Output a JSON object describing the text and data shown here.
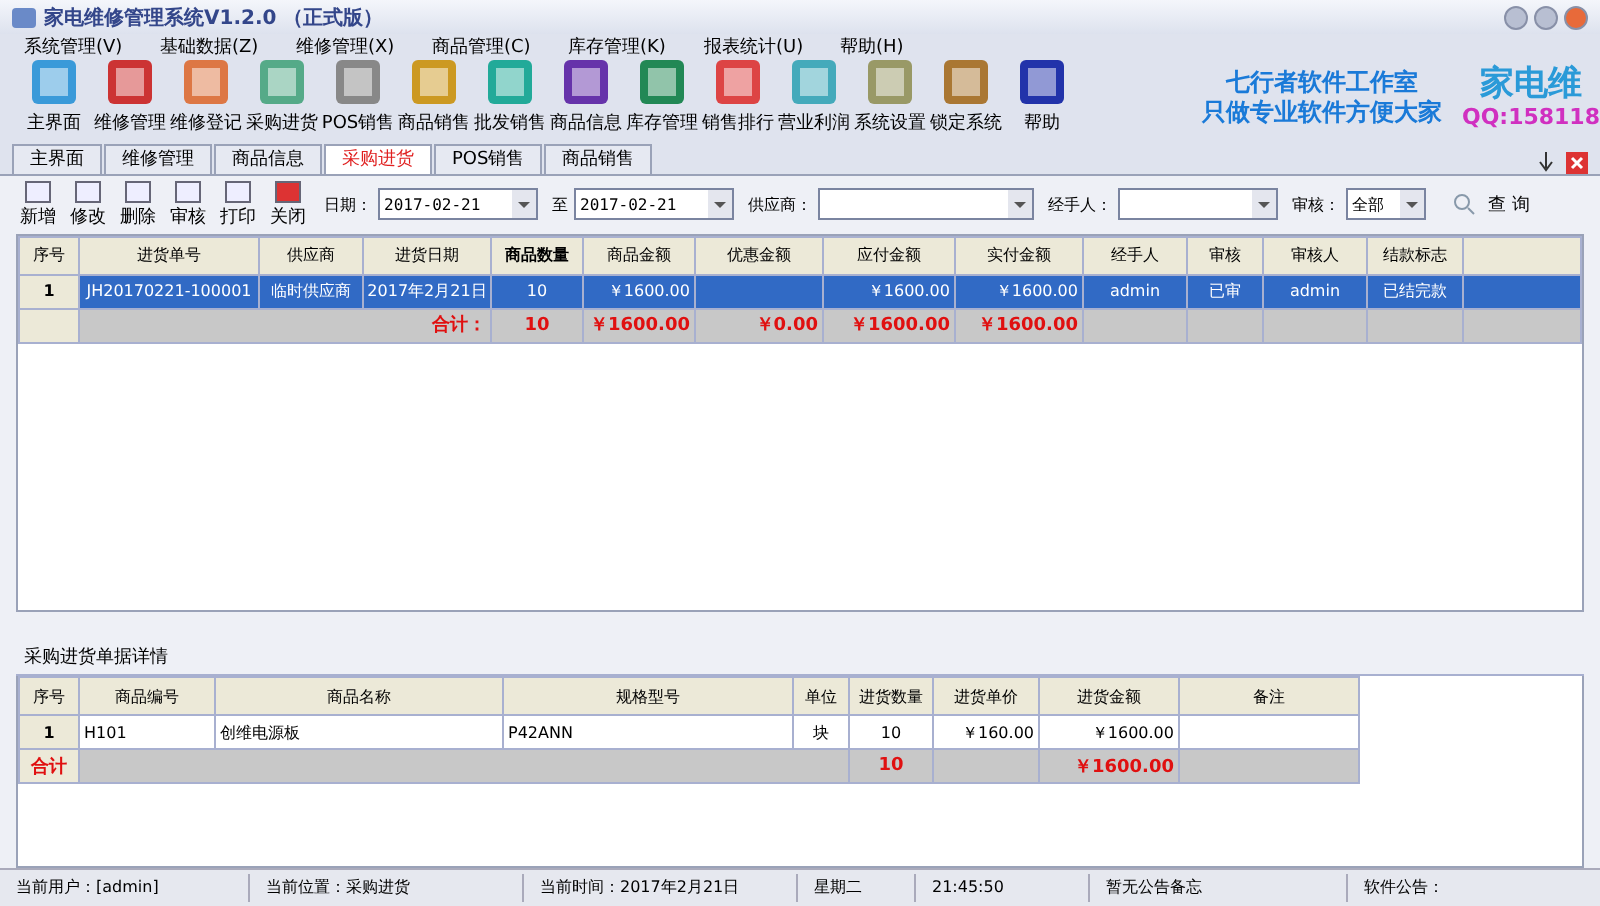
{
  "window": {
    "title": "家电维修管理系统V1.2.0 （正式版）"
  },
  "menu": [
    "系统管理(V)",
    "基础数据(Z)",
    "维修管理(X)",
    "商品管理(C)",
    "库存管理(K)",
    "报表统计(U)",
    "帮助(H)"
  ],
  "toolbar": [
    "主界面",
    "维修管理",
    "维修登记",
    "采购进货",
    "POS销售",
    "商品销售",
    "批发销售",
    "商品信息",
    "库存管理",
    "销售排行",
    "营业利润",
    "系统设置",
    "锁定系统",
    "帮助"
  ],
  "banner": {
    "line_1": "七行者软件工作室",
    "line_2": "只做专业软件方便大家",
    "brand": "家电维",
    "qq": "QQ:158118"
  },
  "tabs": [
    {
      "label": "主界面",
      "selected": false
    },
    {
      "label": "维修管理",
      "selected": false
    },
    {
      "label": "商品信息",
      "selected": false
    },
    {
      "label": "采购进货",
      "selected": true
    },
    {
      "label": "POS销售",
      "selected": false
    },
    {
      "label": "商品销售",
      "selected": false
    }
  ],
  "actions": [
    "新增",
    "修改",
    "删除",
    "审核",
    "打印",
    "关闭"
  ],
  "filters": {
    "date_label": "日期：",
    "date_from": "2017-02-21",
    "to_label": "至",
    "date_to": "2017-02-21",
    "supplier_label": "供应商：",
    "handler_label": "经手人：",
    "audit_label": "审核：",
    "audit_value": "全部",
    "query": "查 询"
  },
  "orders": {
    "columns": [
      "序号",
      "进货单号",
      "供应商",
      "进货日期",
      "商品数量",
      "商品金额",
      "优惠金额",
      "应付金额",
      "实付金额",
      "经手人",
      "审核",
      "审核人",
      "结款标志"
    ],
    "rows": [
      {
        "cells": [
          "1",
          "JH20170221-100001",
          "临时供应商",
          "2017年2月21日",
          "10",
          "￥1600.00",
          "",
          "￥1600.00",
          "￥1600.00",
          "admin",
          "已审",
          "admin",
          "已结完款"
        ],
        "selected": true
      }
    ],
    "total": {
      "label": "合计：",
      "qty": "10",
      "amount": "￥1600.00",
      "discount": "￥0.00",
      "payable": "￥1600.00",
      "paid": "￥1600.00"
    }
  },
  "details": {
    "title": "采购进货单据详情",
    "columns": [
      "序号",
      "商品编号",
      "商品名称",
      "规格型号",
      "单位",
      "进货数量",
      "进货单价",
      "进货金额",
      "备注"
    ],
    "rows": [
      [
        "1",
        "H101",
        "创维电源板",
        "P42ANN",
        "块",
        "10",
        "￥160.00",
        "￥1600.00",
        ""
      ]
    ],
    "total": {
      "label": "合计",
      "qty": "10",
      "amount": "￥1600.00"
    }
  },
  "status_bar": [
    "当前用户：[admin]",
    "当前位置：采购进货",
    "当前时间：2017年2月21日",
    "星期二",
    "21:45:50",
    "暂无公告备忘",
    "软件公告："
  ]
}
